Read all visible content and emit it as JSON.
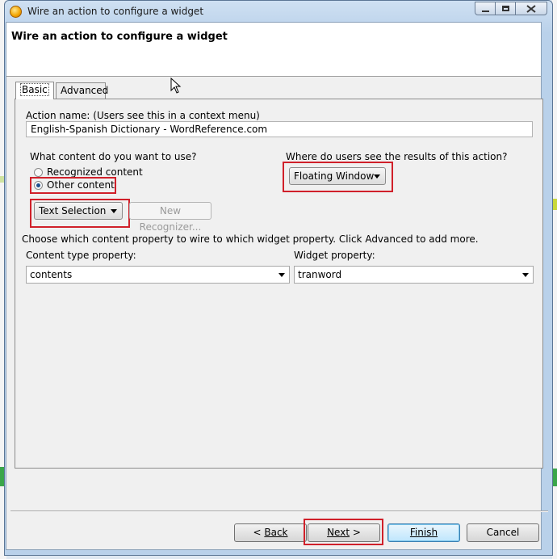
{
  "window": {
    "title": "Wire an action to configure a widget"
  },
  "header": {
    "title": "Wire an action to configure a widget"
  },
  "tabs": [
    {
      "label": "Basic",
      "selected": true
    },
    {
      "label": "Advanced",
      "selected": false
    }
  ],
  "action": {
    "name_label": "Action name: (Users see this in a context menu)",
    "name_value": "English-Spanish Dictionary - WordReference.com"
  },
  "content": {
    "question": "What content do you want to use?",
    "options": [
      {
        "label": "Recognized content",
        "checked": false
      },
      {
        "label": "Other content",
        "checked": true
      }
    ],
    "source_selected": "Text Selection",
    "new_recognizer_label": "New Recognizer..."
  },
  "results": {
    "question": "Where do users see the results of this action?",
    "selected": "Floating Window"
  },
  "mapping": {
    "instruction": "Choose which content property to wire to which widget property. Click Advanced to add more.",
    "content_type_label": "Content type property:",
    "content_type_value": "contents",
    "widget_property_label": "Widget property:",
    "widget_property_value": "tranword"
  },
  "footer": {
    "back_prefix": "< ",
    "back_label": "Back",
    "next_label": "Next",
    "next_suffix": " >",
    "finish_label": "Finish",
    "cancel_label": "Cancel"
  },
  "colors": {
    "highlight": "#d0202a",
    "accent": "#1d4f8e"
  }
}
